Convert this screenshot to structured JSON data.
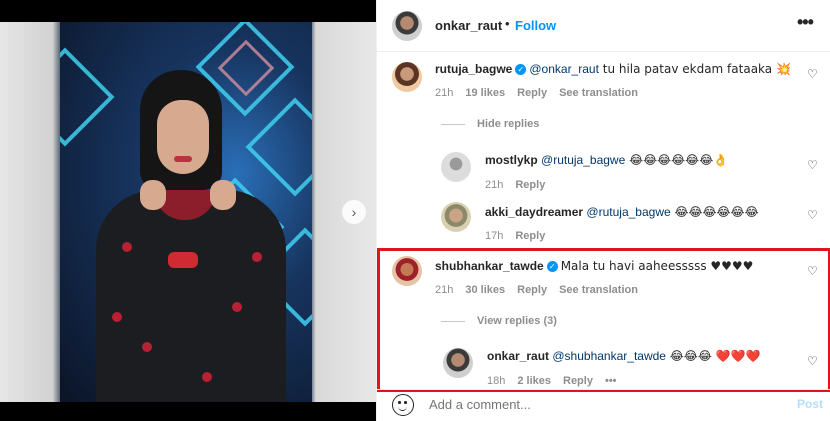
{
  "post": {
    "owner": "onkar_raut",
    "separator": "•",
    "follow_label": "Follow",
    "more_icon": "more-options-icon"
  },
  "media": {
    "next_icon": "chevron-right-icon",
    "carousel_dots": 3,
    "active_dot": 1
  },
  "comments": [
    {
      "username": "rutuja_bagwe",
      "verified": true,
      "mention": "@onkar_raut",
      "text": " tu hila patav ekdam fataaka 💥",
      "time": "21h",
      "likes": "19 likes",
      "reply_label": "Reply",
      "translate_label": "See translation",
      "replies_toggle": "Hide replies"
    },
    {
      "username": "mostlykp",
      "mention": "@rutuja_bagwe",
      "text": " 😂😂😂😂😂😂👌",
      "time": "21h",
      "reply_label": "Reply"
    },
    {
      "username": "akki_daydreamer",
      "mention": "@rutuja_bagwe",
      "text": " 😂😂😂😂😂😂",
      "time": "17h",
      "reply_label": "Reply"
    },
    {
      "username": "shubhankar_tawde",
      "verified": true,
      "text": "Mala tu havi aaheesssss ♥♥♥♥",
      "time": "21h",
      "likes": "30 likes",
      "reply_label": "Reply",
      "translate_label": "See translation",
      "replies_toggle": "View replies (3)"
    },
    {
      "username": "onkar_raut",
      "mention": "@shubhankar_tawde",
      "text": " 😂😂😂 ❤️❤️❤️",
      "time": "18h",
      "likes": "2 likes",
      "reply_label": "Reply",
      "more_label": "•••"
    }
  ],
  "footer": {
    "placeholder": "Add a comment...",
    "post_label": "Post"
  },
  "colors": {
    "accent": "#0095f6",
    "highlight": "#e0141b",
    "mention": "#00376b",
    "muted": "#8e8e8e"
  }
}
